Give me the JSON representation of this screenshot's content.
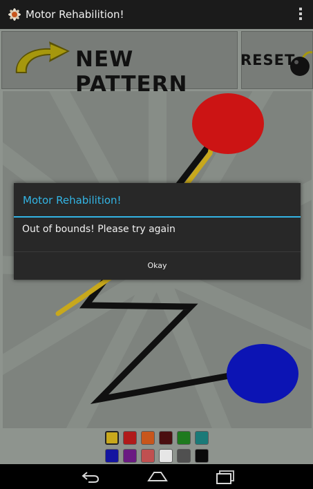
{
  "app": {
    "title": "Motor Rehabilition!"
  },
  "toolbar": {
    "new_pattern_label": "NEW PATTERN",
    "reset_label": "RESET"
  },
  "dialog": {
    "title": "Motor Rehabilition!",
    "message": "Out of bounds!  Please try again",
    "button_label": "Okay"
  },
  "palette": {
    "colors_row1": [
      "#c8a81c",
      "#b01a1a",
      "#c8561c",
      "#4a0e10",
      "#1e7a1e",
      "#1a7a78"
    ],
    "colors_row2": [
      "#1414a0",
      "#6a1a82",
      "#c05050",
      "#e6e6e6",
      "#505050",
      "#0a0a0a"
    ],
    "selected": 0
  },
  "colors": {
    "accent": "#33b5e5",
    "start_dot": "#cc1414",
    "end_dot": "#0c14b4",
    "trace": "#c8a81c",
    "pattern": "#101010"
  },
  "nav": {
    "icons": [
      "back-icon",
      "home-icon",
      "recent-apps-icon"
    ]
  }
}
